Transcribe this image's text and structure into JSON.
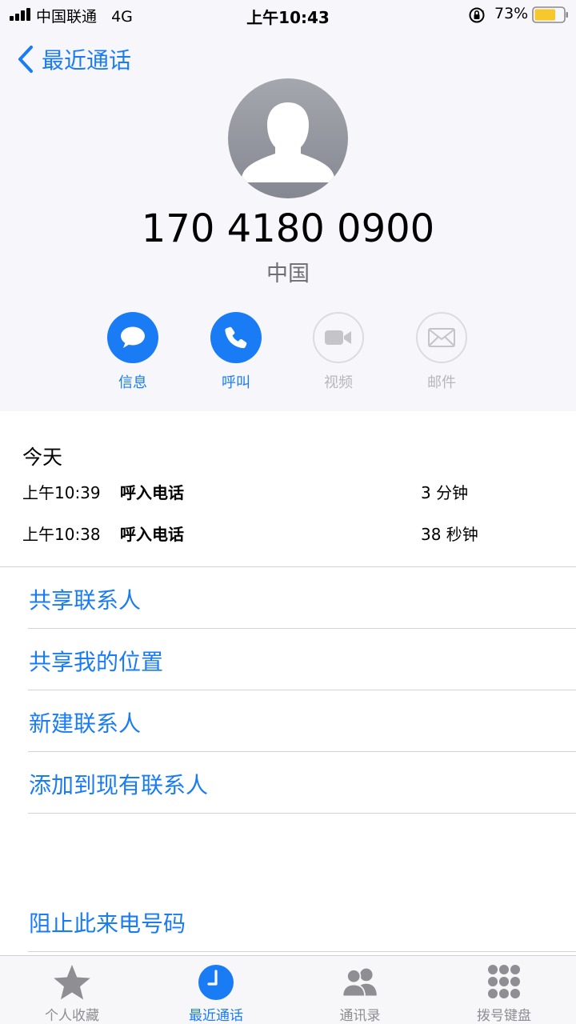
{
  "status_bar": {
    "carrier": "中国联通",
    "network": "4G",
    "time": "上午10:43",
    "battery_percent": "73%",
    "battery_level": 0.73
  },
  "header": {
    "back_label": "最近通话",
    "phone_number": "170 4180 0900",
    "region": "中国"
  },
  "actions": [
    {
      "label": "信息",
      "icon": "message-icon",
      "enabled": true
    },
    {
      "label": "呼叫",
      "icon": "phone-icon",
      "enabled": true
    },
    {
      "label": "视频",
      "icon": "video-icon",
      "enabled": false
    },
    {
      "label": "邮件",
      "icon": "mail-icon",
      "enabled": false
    }
  ],
  "calls": {
    "section_title": "今天",
    "items": [
      {
        "time": "上午10:39",
        "kind": "呼入电话",
        "duration": "3 分钟"
      },
      {
        "time": "上午10:38",
        "kind": "呼入电话",
        "duration": "38 秒钟"
      }
    ]
  },
  "menu": {
    "share_contact": "共享联系人",
    "share_location": "共享我的位置",
    "new_contact": "新建联系人",
    "add_to_existing": "添加到现有联系人",
    "block_caller": "阻止此来电号码"
  },
  "tabbar": {
    "favorites": "个人收藏",
    "recents": "最近通话",
    "contacts": "通讯录",
    "keypad": "拨号键盘"
  },
  "colors": {
    "accent": "#1a7cf5",
    "header_bg": "#f7f7fb",
    "disabled": "#b6b6bb"
  }
}
